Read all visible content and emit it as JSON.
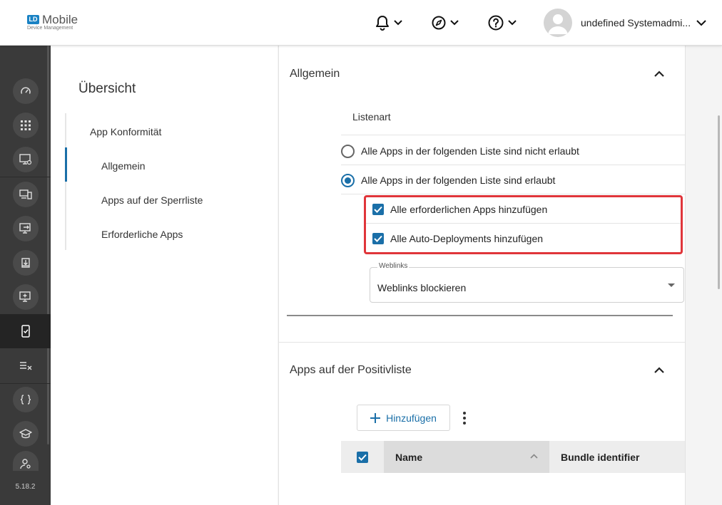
{
  "header": {
    "logo_badge": "LD",
    "logo_name": "Mobile",
    "logo_subtitle": "Device Management",
    "notifications_icon": "bell-icon",
    "compass_icon": "compass-icon",
    "help_icon": "question-circle-icon",
    "user_name": "undefined Systemadmi..."
  },
  "rail": {
    "items": [
      {
        "icon": "speedometer-icon"
      },
      {
        "icon": "apps-grid-icon"
      },
      {
        "icon": "monitor-settings-icon"
      },
      {
        "icon": "devices-icon"
      },
      {
        "icon": "monitor-arrow-icon"
      },
      {
        "icon": "download-tray-icon"
      },
      {
        "icon": "monitor-plus-icon"
      },
      {
        "icon": "phone-check-icon",
        "active": true
      },
      {
        "icon": "list-x-icon"
      },
      {
        "icon": "braces-icon"
      },
      {
        "icon": "graduation-cap-icon"
      },
      {
        "icon": "user-settings-icon"
      }
    ],
    "version": "5.18.2"
  },
  "subnav": {
    "title": "Übersicht",
    "items": [
      {
        "label": "App Konformität"
      },
      {
        "label": "Allgemein"
      },
      {
        "label": "Apps auf der Sperrliste"
      },
      {
        "label": "Erforderliche Apps"
      }
    ]
  },
  "general": {
    "title": "Allgemein",
    "list_type_label": "Listenart",
    "radio_options": [
      {
        "label": "Alle Apps in der folgenden Liste sind nicht erlaubt",
        "selected": false
      },
      {
        "label": "Alle Apps in der folgenden Liste sind erlaubt",
        "selected": true
      }
    ],
    "checkboxes": [
      {
        "label": "Alle erforderlichen Apps hinzufügen",
        "checked": true
      },
      {
        "label": "Alle Auto-Deployments hinzufügen",
        "checked": true
      }
    ],
    "weblinks": {
      "label": "Weblinks",
      "value": "Weblinks blockieren"
    }
  },
  "positive_list": {
    "title": "Apps auf der Positivliste",
    "add_label": "Hinzufügen",
    "columns": [
      "Name",
      "Bundle identifier"
    ],
    "header_checked": true
  },
  "colors": {
    "accent": "#1a6fa8",
    "highlight": "#e0353a",
    "rail": "#3a3a3a"
  }
}
